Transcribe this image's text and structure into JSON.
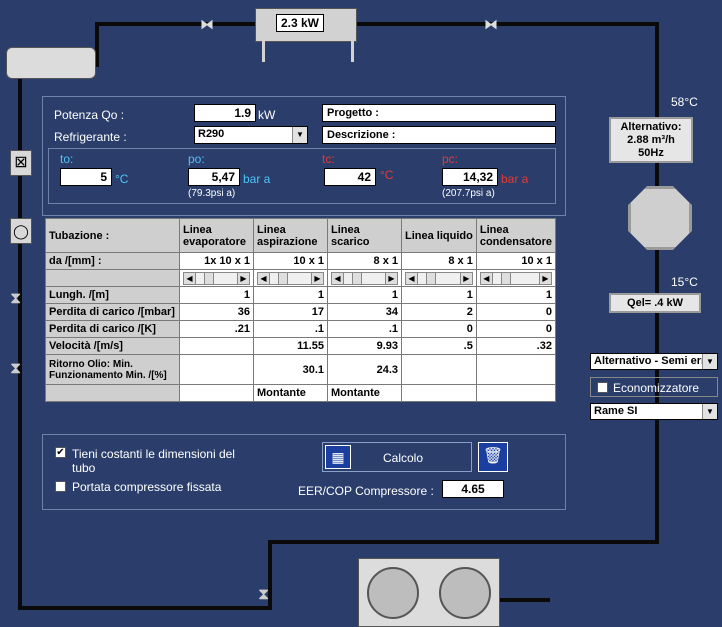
{
  "condenser_top": {
    "power": "2.3 kW"
  },
  "temps": {
    "discharge": "58°C",
    "suction": "15°C"
  },
  "compressor_box": {
    "line1": "Alternativo:",
    "line2": "2.88 m³/h",
    "line3": "50Hz"
  },
  "qel_box": {
    "text": "Qel= .4 kW"
  },
  "form": {
    "potenza_label": "Potenza Qo :",
    "potenza_value": "1.9",
    "potenza_unit": "kW",
    "refrigerante_label": "Refrigerante :",
    "refrigerante_value": "R290",
    "progetto_label": "Progetto :",
    "descrizione_label": "Descrizione :"
  },
  "conditions": {
    "to_label": "to:",
    "to_value": "5",
    "to_unit": "°C",
    "po_label": "po:",
    "po_value": "5,47",
    "po_unit": "bar a",
    "po_psi": "(79.3psi a)",
    "tc_label": "tc:",
    "tc_value": "42",
    "tc_unit": "°C",
    "pc_label": "pc:",
    "pc_value": "14,32",
    "pc_unit": "bar a",
    "pc_psi": "(207.7psi a)"
  },
  "table": {
    "headers": [
      "Tubazione :",
      "Linea evaporatore",
      "Linea aspirazione",
      "Linea scarico",
      "Linea liquido",
      "Linea condensatore"
    ],
    "rows": [
      {
        "label": "da  /[mm] :",
        "values": [
          "1x 10 x 1",
          "10 x 1",
          "8 x 1",
          "8 x 1",
          "10 x 1"
        ]
      },
      {
        "label": "Lungh. /[m]",
        "values": [
          "1",
          "1",
          "1",
          "1",
          "1"
        ]
      },
      {
        "label": "Perdita di carico /[mbar]",
        "values": [
          "36",
          "17",
          "34",
          "2",
          "0"
        ]
      },
      {
        "label": "Perdita di carico /[K]",
        "values": [
          ".21",
          ".1",
          ".1",
          "0",
          "0"
        ]
      },
      {
        "label": "Velocità /[m/s]",
        "values": [
          "",
          "11.55",
          "9.93",
          ".5",
          ".32"
        ]
      },
      {
        "label": "Ritorno Olio: Min. Funzionamento Min. /[%]",
        "values": [
          "",
          "30.1",
          "24.3",
          "",
          ""
        ]
      },
      {
        "label": "",
        "values": [
          "",
          "Montante",
          "Montante",
          "",
          ""
        ]
      }
    ]
  },
  "options": {
    "tieni_costanti": "Tieni costanti le dimensioni del tubo",
    "tieni_checked": true,
    "portata_fissata": "Portata compressore fissata",
    "portata_checked": false,
    "calcolo": "Calcolo",
    "eer_label": "EER/COP Compressore :",
    "eer_value": "4.65"
  },
  "right_controls": {
    "compressor_type": "Alternativo - Semi ermetico",
    "economizzatore": "Economizzatore",
    "economizzatore_checked": false,
    "pipe_material": "Rame SI"
  },
  "colors": {
    "background": "#2b3e6b",
    "cyan": "#4fc3f7",
    "red": "#e53935"
  }
}
